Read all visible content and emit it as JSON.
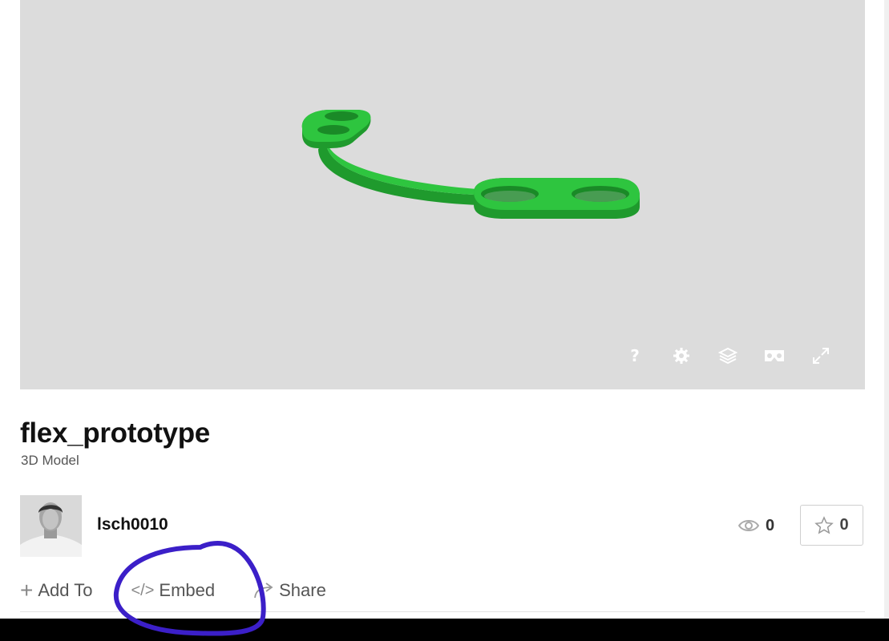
{
  "model": {
    "title": "flex_prototype",
    "type_label": "3D Model",
    "color": "#2ab13a"
  },
  "viewer": {
    "background": "#dcdcdc",
    "tools": [
      {
        "name": "help",
        "icon": "question-icon",
        "glyph": "?"
      },
      {
        "name": "settings",
        "icon": "gear-icon"
      },
      {
        "name": "layers",
        "icon": "layers-icon"
      },
      {
        "name": "vr",
        "icon": "vr-headset-icon"
      },
      {
        "name": "fullscreen",
        "icon": "expand-icon"
      }
    ]
  },
  "author": {
    "username": "lsch0010"
  },
  "stats": {
    "views": "0",
    "likes": "0"
  },
  "actions": {
    "add_to": "Add To",
    "embed": "Embed",
    "share": "Share"
  },
  "icons": {
    "add": "+",
    "embed": "</>",
    "share_icon": "share-arrow-icon"
  },
  "annotation_color": "#3b1fc8"
}
